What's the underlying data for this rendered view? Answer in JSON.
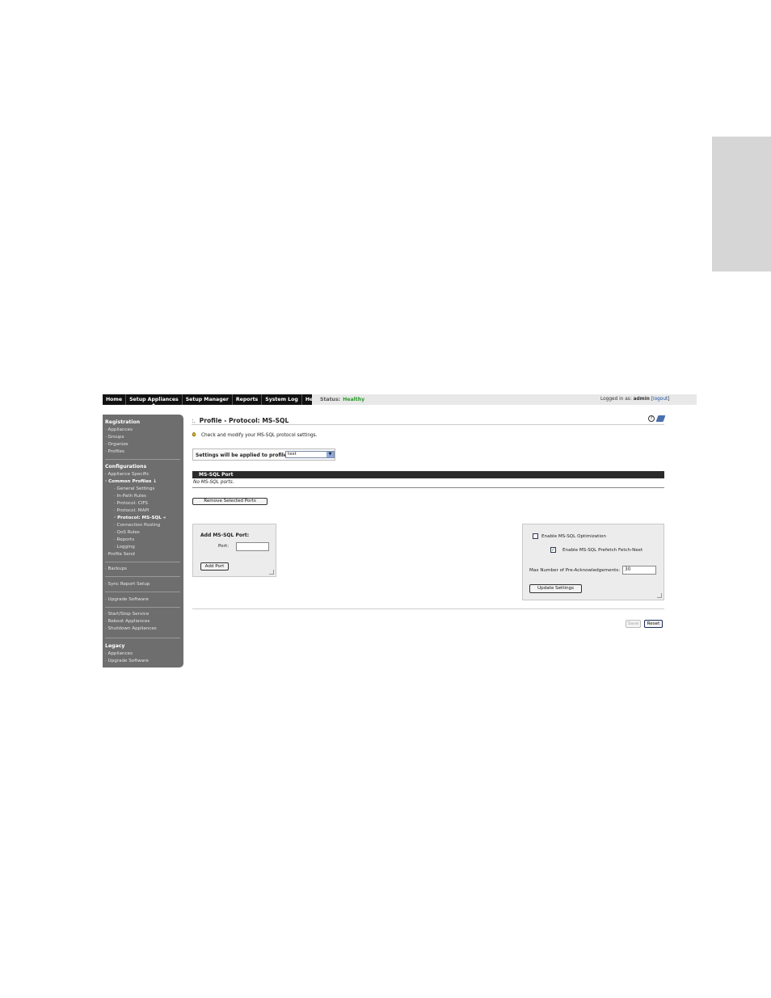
{
  "nav": {
    "items": [
      {
        "label": "Home"
      },
      {
        "label": "Setup Appliances"
      },
      {
        "label": "Setup Manager"
      },
      {
        "label": "Reports"
      },
      {
        "label": "System Log"
      },
      {
        "label": "Help"
      }
    ],
    "status_label": "Status:",
    "status_value": "Healthy",
    "logged_in_label": "Logged in as:",
    "user": "admin",
    "logout": "logout"
  },
  "sidebar": {
    "registration": "Registration",
    "reg_items": [
      "· Appliances",
      "· Groups",
      "· Organize",
      "· Profiles"
    ],
    "configurations": "Configurations",
    "appliance_specific": "· Appliance Specific",
    "common_profiles": "· Common Profiles ↓",
    "sub_items": [
      "· General Settings",
      "· In-Path Rules",
      "· Protocol: CIFS",
      "· Protocol: MAPI",
      "· Protocol: MS-SQL «",
      "· Connection Pooling",
      "· QoS Rules",
      "· Reports",
      "· Logging"
    ],
    "profile_send": "· Profile Send",
    "backups": "· Backups",
    "sync_report": "· Sync Report Setup",
    "upgrade_software": "· Upgrade Software",
    "service_items": [
      "· Start/Stop Service",
      "· Reboot Appliances",
      "· Shutdown Appliances"
    ],
    "legacy": "Legacy",
    "legacy_items": [
      "· Appliances",
      "· Upgrade Software"
    ]
  },
  "main": {
    "title_marker": ":.",
    "title": "Profile - Protocol: MS-SQL",
    "help_glyph": "?",
    "tip": "Check and modify your MS-SQL protocol settings.",
    "profile_label": "Settings will be applied to profile:",
    "profile_value": "test",
    "section_title": "MS-SQL Port",
    "empty_text": "No MS-SQL ports.",
    "remove_button": "Remove Selected Ports",
    "add_port_title": "Add MS-SQL Port:",
    "port_label": "Port:",
    "add_port_button": "Add Port",
    "enable_opt_label": "Enable MS-SQL Optimization",
    "enable_opt_checked": false,
    "prefetch_label": "Enable MS-SQL Prefetch Fetch-Next",
    "prefetch_checked": true,
    "check_glyph": "✓",
    "max_label": "Max Number of Pre-Acknowledgements:",
    "max_value": "30",
    "update_button": "Update Settings",
    "save_button": "Save",
    "reset_button": "Reset"
  },
  "icons": {
    "help": "help-icon",
    "print": "print-icon",
    "tip": "lightbulb-icon",
    "select_arrow": "chevron-down-icon"
  },
  "colors": {
    "status_ok": "#2a9a2a",
    "sidebar_bg": "#6e6e6e",
    "nav_bg": "#111111",
    "section_bar": "#2b2b2b"
  }
}
